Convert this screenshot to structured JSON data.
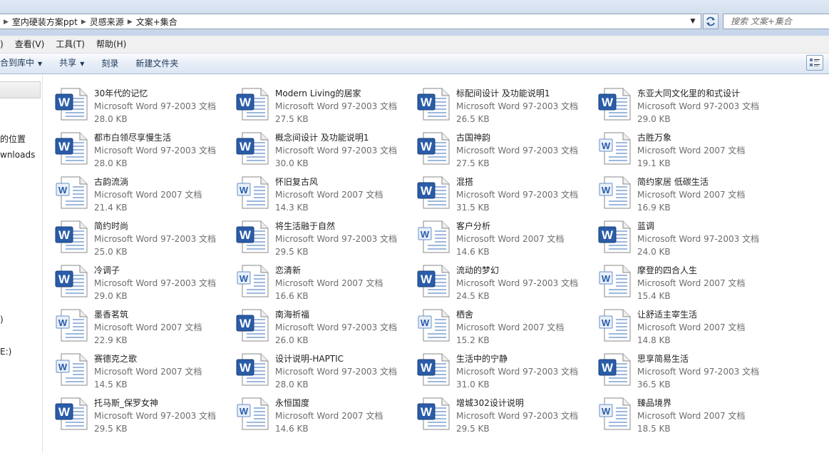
{
  "address": {
    "breadcrumbs": [
      "室内硬装方案ppt",
      "灵感来源",
      "文案+集合"
    ],
    "search_placeholder": "搜索 文案+集合"
  },
  "menu": [
    ")",
    "查看(V)",
    "工具(T)",
    "帮助(H)"
  ],
  "toolbar": {
    "include_label": "合到库中",
    "share_label": "共享",
    "burn_label": "刻录",
    "new_folder_label": "新建文件夹"
  },
  "nav": {
    "items": [
      "的位置",
      "wnloads",
      ")",
      "E:)"
    ]
  },
  "files": [
    {
      "name": "30年代的记忆",
      "type": "Microsoft Word 97-2003 文档",
      "size": "28.0 KB",
      "icon": "word-97-2003-icon"
    },
    {
      "name": "Modern Living的居家",
      "type": "Microsoft Word 97-2003 文档",
      "size": "27.5 KB",
      "icon": "word-97-2003-icon"
    },
    {
      "name": "标配间设计 及功能说明1",
      "type": "Microsoft Word 97-2003 文档",
      "size": "26.5 KB",
      "icon": "word-97-2003-icon"
    },
    {
      "name": "东亚大同文化里的和式设计",
      "type": "Microsoft Word 97-2003 文档",
      "size": "29.0 KB",
      "icon": "word-97-2003-icon"
    },
    {
      "name": "都市白领尽享慢生活",
      "type": "Microsoft Word 97-2003 文档",
      "size": "28.0 KB",
      "icon": "word-97-2003-icon"
    },
    {
      "name": "概念间设计 及功能说明1",
      "type": "Microsoft Word 97-2003 文档",
      "size": "30.0 KB",
      "icon": "word-97-2003-icon"
    },
    {
      "name": "古国神韵",
      "type": "Microsoft Word 97-2003 文档",
      "size": "27.5 KB",
      "icon": "word-97-2003-icon"
    },
    {
      "name": "古胜万象",
      "type": "Microsoft Word 2007 文档",
      "size": "19.1 KB",
      "icon": "word-2007-icon"
    },
    {
      "name": "古韵流淌",
      "type": "Microsoft Word 2007 文档",
      "size": "21.4 KB",
      "icon": "word-2007-icon"
    },
    {
      "name": "怀旧复古风",
      "type": "Microsoft Word 2007 文档",
      "size": "14.3 KB",
      "icon": "word-2007-icon"
    },
    {
      "name": "混搭",
      "type": "Microsoft Word 97-2003 文档",
      "size": "31.5 KB",
      "icon": "word-97-2003-icon"
    },
    {
      "name": "简约家居 低碳生活",
      "type": "Microsoft Word 2007 文档",
      "size": "16.9 KB",
      "icon": "word-2007-icon"
    },
    {
      "name": "简约时尚",
      "type": "Microsoft Word 97-2003 文档",
      "size": "25.0 KB",
      "icon": "word-97-2003-icon"
    },
    {
      "name": "将生活融于自然",
      "type": "Microsoft Word 97-2003 文档",
      "size": "29.5 KB",
      "icon": "word-97-2003-icon"
    },
    {
      "name": "客户分析",
      "type": "Microsoft Word 2007 文档",
      "size": "14.6 KB",
      "icon": "word-2007-icon"
    },
    {
      "name": "蓝调",
      "type": "Microsoft Word 97-2003 文档",
      "size": "24.0 KB",
      "icon": "word-97-2003-icon"
    },
    {
      "name": "冷调子",
      "type": "Microsoft Word 97-2003 文档",
      "size": "29.0 KB",
      "icon": "word-97-2003-icon"
    },
    {
      "name": "恋清新",
      "type": "Microsoft Word 2007 文档",
      "size": "16.6 KB",
      "icon": "word-2007-icon"
    },
    {
      "name": "流动的梦幻",
      "type": "Microsoft Word 97-2003 文档",
      "size": "24.5 KB",
      "icon": "word-97-2003-icon"
    },
    {
      "name": "摩登的四合人生",
      "type": "Microsoft Word 2007 文档",
      "size": "15.4 KB",
      "icon": "word-2007-icon"
    },
    {
      "name": "墨香茗筑",
      "type": "Microsoft Word 2007 文档",
      "size": "22.9 KB",
      "icon": "word-2007-icon"
    },
    {
      "name": "南海祈福",
      "type": "Microsoft Word 97-2003 文档",
      "size": "26.0 KB",
      "icon": "word-97-2003-icon"
    },
    {
      "name": "栖舍",
      "type": "Microsoft Word 2007 文档",
      "size": "15.2 KB",
      "icon": "word-2007-icon"
    },
    {
      "name": "让舒适主宰生活",
      "type": "Microsoft Word 2007 文档",
      "size": "14.8 KB",
      "icon": "word-2007-icon"
    },
    {
      "name": "赛德克之歌",
      "type": "Microsoft Word 2007 文档",
      "size": "14.5 KB",
      "icon": "word-2007-icon"
    },
    {
      "name": "设计说明-HAPTIC",
      "type": "Microsoft Word 97-2003 文档",
      "size": "28.0 KB",
      "icon": "word-97-2003-icon"
    },
    {
      "name": "生活中的宁静",
      "type": "Microsoft Word 97-2003 文档",
      "size": "31.0 KB",
      "icon": "word-97-2003-icon"
    },
    {
      "name": "思享简易生活",
      "type": "Microsoft Word 97-2003 文档",
      "size": "36.5 KB",
      "icon": "word-97-2003-icon"
    },
    {
      "name": "托马斯_保罗女神",
      "type": "Microsoft Word 97-2003 文档",
      "size": "29.5 KB",
      "icon": "word-97-2003-icon"
    },
    {
      "name": "永恒国度",
      "type": "Microsoft Word 2007 文档",
      "size": "14.6 KB",
      "icon": "word-2007-icon"
    },
    {
      "name": "增城302设计说明",
      "type": "Microsoft Word 97-2003 文档",
      "size": "29.5 KB",
      "icon": "word-97-2003-icon"
    },
    {
      "name": "臻品境界",
      "type": "Microsoft Word 2007 文档",
      "size": "18.5 KB",
      "icon": "word-2007-icon"
    }
  ]
}
